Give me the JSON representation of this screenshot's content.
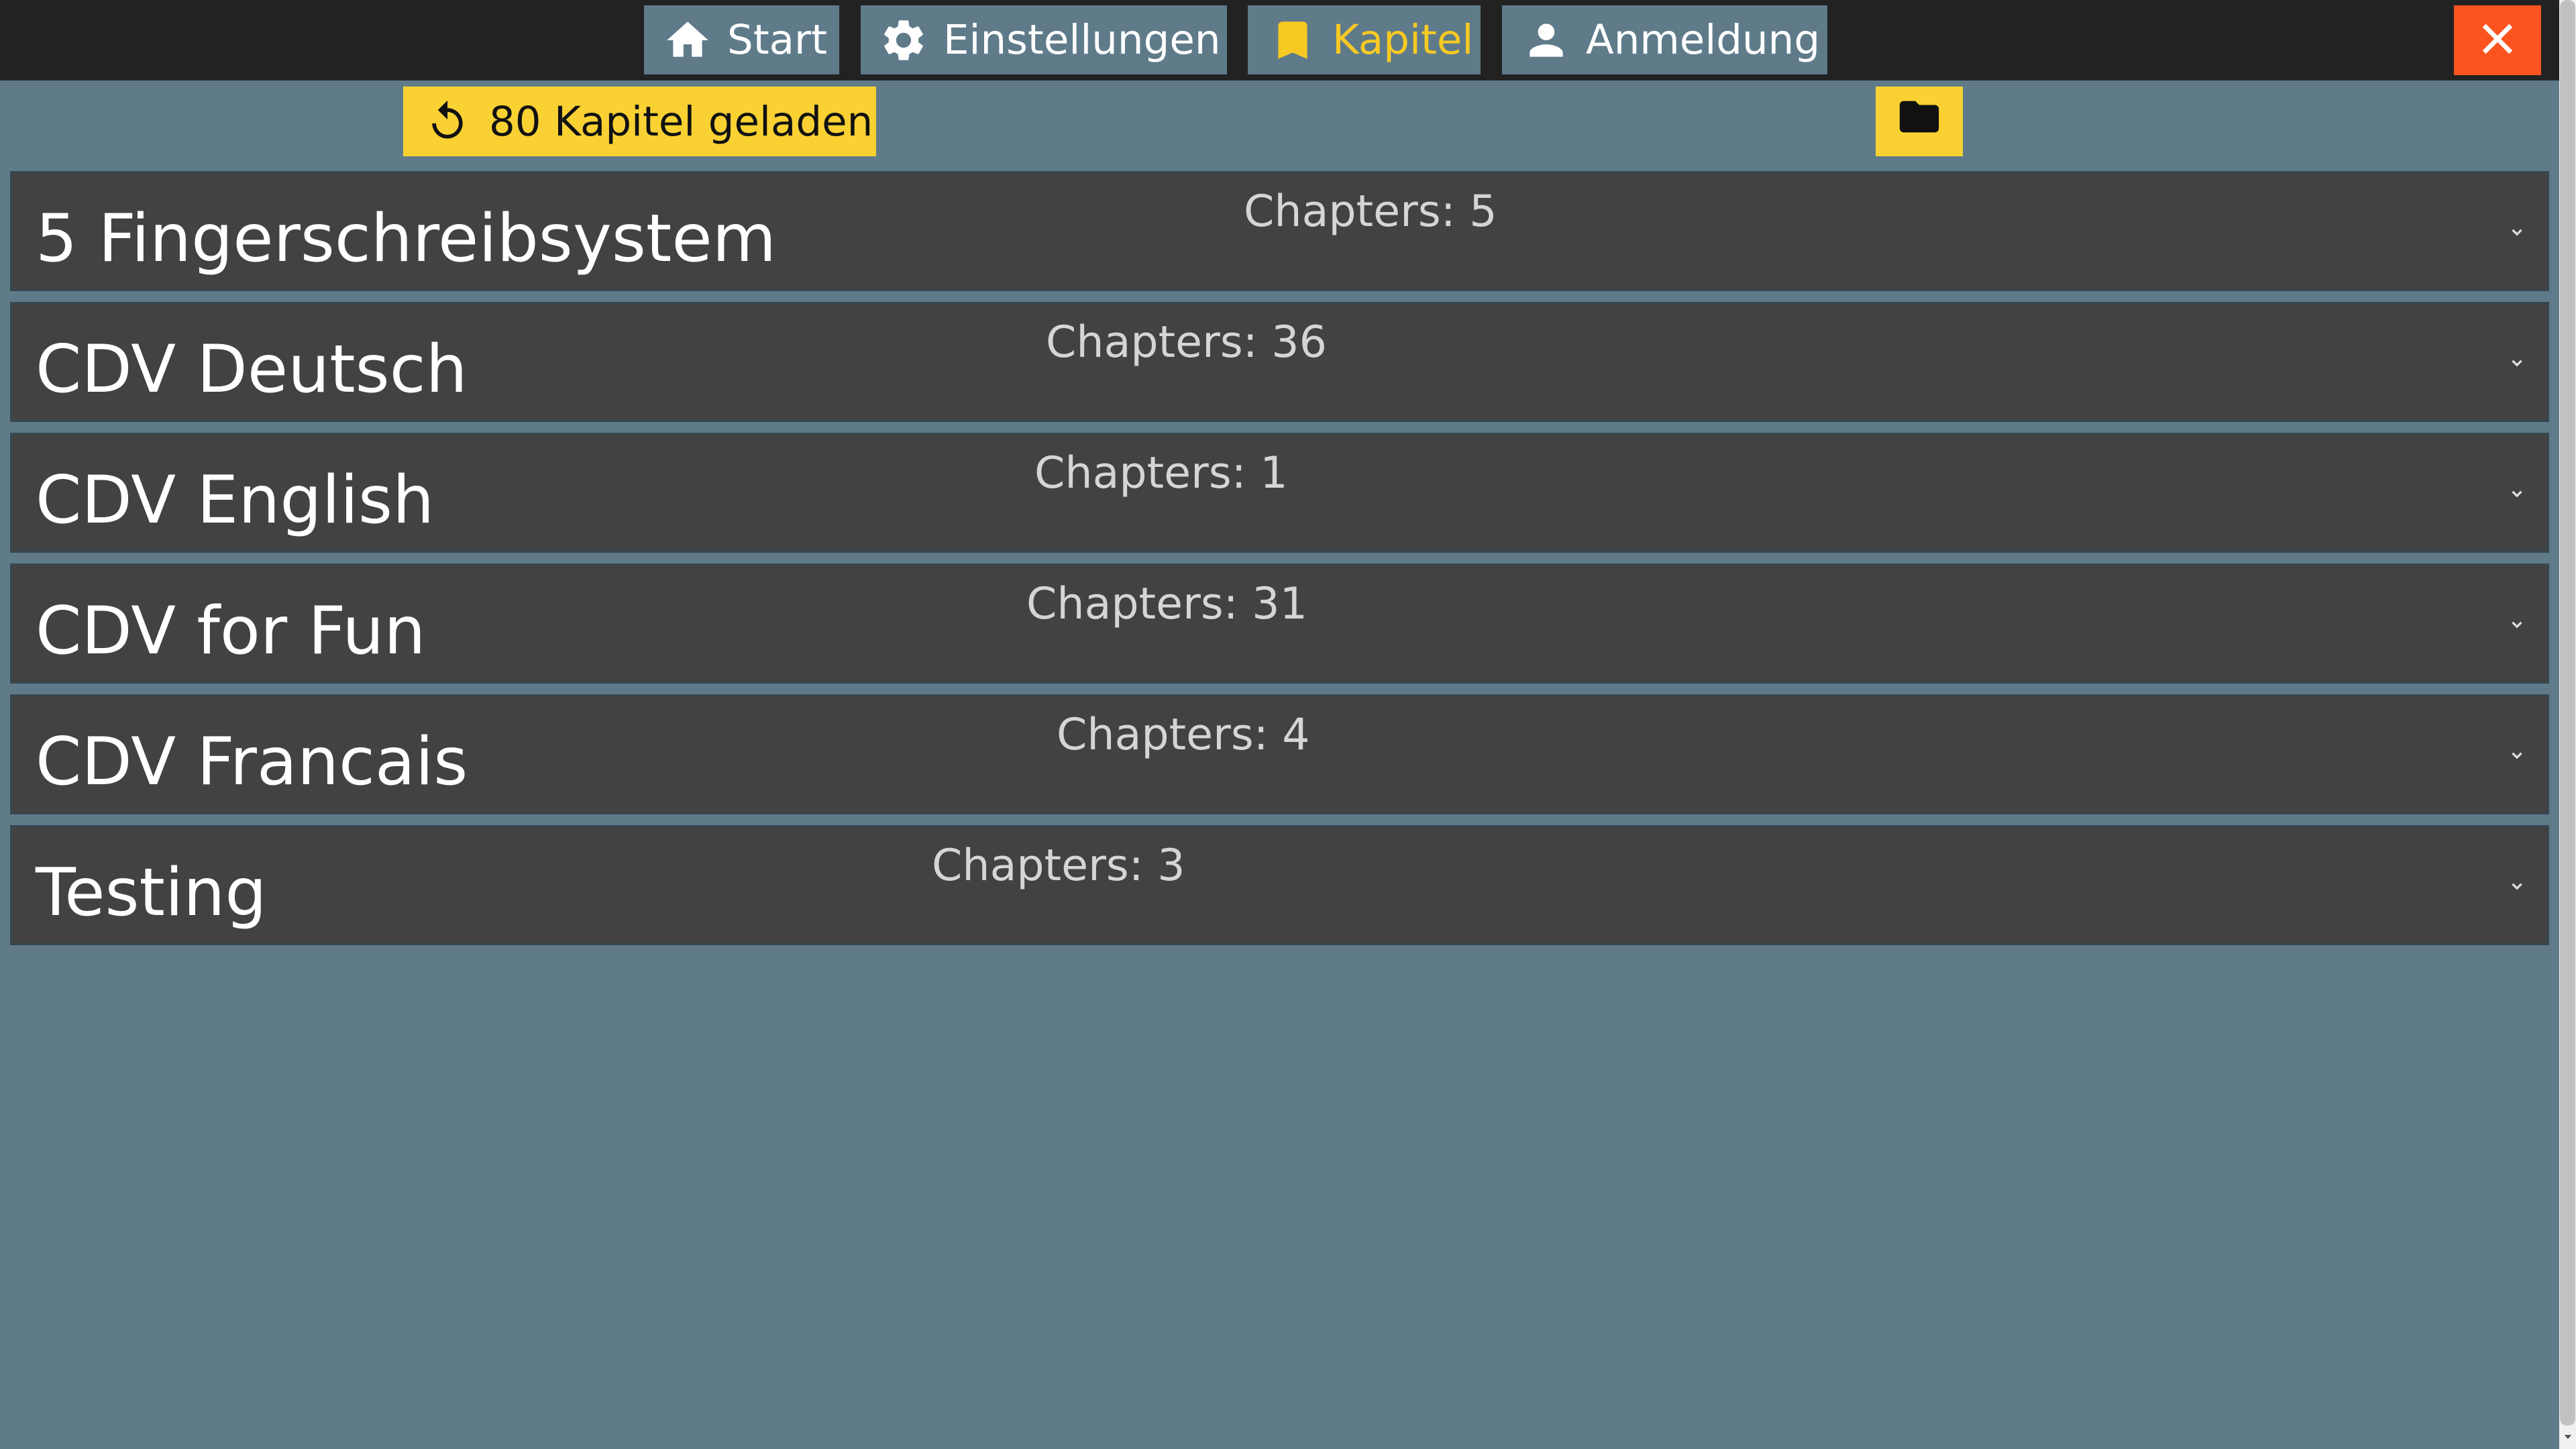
{
  "nav": {
    "start_label": "Start",
    "settings_label": "Einstellungen",
    "chapters_label": "Kapitel",
    "login_label": "Anmeldung",
    "active_tab": "Kapitel",
    "active_color": "#f7c923"
  },
  "toolbar": {
    "reload_label": "80 Kapitel geladen",
    "reload_icon": "reload-icon",
    "folder_icon": "folder-icon"
  },
  "close": {
    "icon": "close-icon",
    "color": "#fc5420"
  },
  "courses": [
    {
      "title": "5 Fingerschreibsystem",
      "count": "Chapters: 5"
    },
    {
      "title": "CDV Deutsch",
      "count": "Chapters: 36"
    },
    {
      "title": "CDV English",
      "count": "Chapters: 1"
    },
    {
      "title": "CDV for Fun",
      "count": "Chapters: 31"
    },
    {
      "title": "CDV Francais",
      "count": "Chapters: 4"
    },
    {
      "title": "Testing",
      "count": "Chapters: 3"
    }
  ],
  "colors": {
    "background": "#5f7b8a",
    "topbar": "#222222",
    "row": "#424242",
    "accent_yellow": "#f9d133"
  }
}
